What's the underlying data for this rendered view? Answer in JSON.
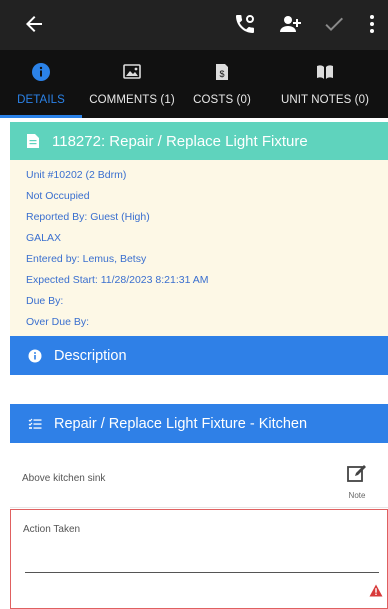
{
  "topbar": {
    "back_icon": "arrow-left-icon",
    "icons": [
      "phone-call-icon",
      "add-user-icon",
      "check-icon",
      "more-vert-icon"
    ]
  },
  "tabs": [
    {
      "label": "DETAILS",
      "icon": "info-icon",
      "active": true
    },
    {
      "label": "COMMENTS (1)",
      "icon": "images-icon",
      "active": false
    },
    {
      "label": "COSTS (0)",
      "icon": "invoice-icon",
      "active": false
    },
    {
      "label": "UNIT NOTES (0)",
      "icon": "book-icon",
      "active": false
    }
  ],
  "work_order": {
    "title": "118272: Repair / Replace Light Fixture",
    "lines": [
      "Unit #10202 (2 Bdrm)",
      "Not Occupied",
      "Reported By: Guest  (High)",
      "GALAX",
      "Entered by: Lemus, Betsy",
      "Expected Start: 11/28/2023 8:21:31 AM",
      "Due By:",
      "Over Due By:"
    ]
  },
  "description": {
    "title": "Description",
    "body": ""
  },
  "task": {
    "title": "Repair / Replace Light Fixture - Kitchen",
    "detail": "Above kitchen sink",
    "note_label": "Note"
  },
  "action": {
    "label": "Action Taken",
    "value": ""
  },
  "colors": {
    "topbar": "#222222",
    "tabbar": "#111111",
    "accent": "#2b82e8",
    "header_teal": "#5fd3bd",
    "info_bg": "#fdf8e6",
    "section_blue": "#2f80e7",
    "warning": "#d83a3a"
  }
}
